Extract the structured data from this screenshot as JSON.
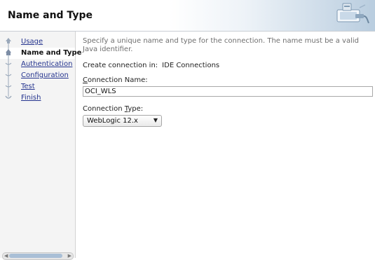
{
  "header": {
    "title": "Name and Type",
    "graphic": "connection-plug-icon"
  },
  "steps": [
    {
      "label": "Usage",
      "state": "visited",
      "icon": "step-visited-icon"
    },
    {
      "label": "Name and Type",
      "state": "current",
      "icon": "step-current-icon"
    },
    {
      "label": "Authentication",
      "state": "pending",
      "icon": "step-pending-icon"
    },
    {
      "label": "Configuration",
      "state": "pending",
      "icon": "step-pending-icon"
    },
    {
      "label": "Test",
      "state": "pending",
      "icon": "step-pending-icon"
    },
    {
      "label": "Finish",
      "state": "pending",
      "icon": "step-end-icon"
    }
  ],
  "form": {
    "description": "Specify a unique name and type for the connection. The name must be a valid Java identifier.",
    "create_in_label": "Create connection in:",
    "create_in_value": "IDE Connections",
    "name_label_mnemonic": "C",
    "name_label_rest": "onnection Name:",
    "name_value": "OCI_WLS",
    "type_label_before": "Connection ",
    "type_label_mnemonic": "T",
    "type_label_after": "ype:",
    "type_value": "WebLogic 12.x"
  },
  "scrollbar": {
    "left_arrow": "left-arrow-icon",
    "right_arrow": "right-arrow-icon"
  },
  "colors": {
    "link": "#24338e",
    "description_text": "#6f6f6f",
    "header_gradient_end": "#b9cddf"
  }
}
